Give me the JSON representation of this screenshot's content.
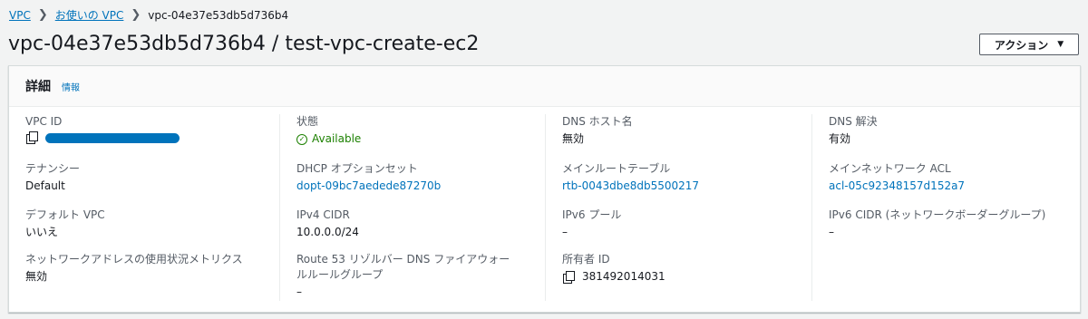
{
  "breadcrumb": {
    "root": "VPC",
    "parent": "お使いの VPC",
    "current": "vpc-04e37e53db5d736b4"
  },
  "page": {
    "title": "vpc-04e37e53db5d736b4 / test-vpc-create-ec2",
    "actions_label": "アクション"
  },
  "panel": {
    "title": "詳細",
    "info_link": "情報"
  },
  "details": {
    "vpc_id": {
      "label": "VPC ID"
    },
    "tenancy": {
      "label": "テナンシー",
      "value": "Default"
    },
    "default_vpc": {
      "label": "デフォルト VPC",
      "value": "いいえ"
    },
    "network_metrics": {
      "label": "ネットワークアドレスの使用状況メトリクス",
      "value": "無効"
    },
    "state": {
      "label": "状態",
      "value": "Available"
    },
    "dhcp": {
      "label": "DHCP オプションセット",
      "value": "dopt-09bc7aedede87270b"
    },
    "ipv4_cidr": {
      "label": "IPv4 CIDR",
      "value": "10.0.0.0/24"
    },
    "route53": {
      "label": "Route 53 リゾルバー DNS ファイアウォールルールグループ",
      "value": "–"
    },
    "dns_hostnames": {
      "label": "DNS ホスト名",
      "value": "無効"
    },
    "main_route_table": {
      "label": "メインルートテーブル",
      "value": "rtb-0043dbe8db5500217"
    },
    "ipv6_pool": {
      "label": "IPv6 プール",
      "value": "–"
    },
    "owner_id": {
      "label": "所有者 ID",
      "value": "381492014031"
    },
    "dns_resolution": {
      "label": "DNS 解決",
      "value": "有効"
    },
    "main_acl": {
      "label": "メインネットワーク ACL",
      "value": "acl-05c92348157d152a7"
    },
    "ipv6_cidr": {
      "label": "IPv6 CIDR (ネットワークボーダーグループ)",
      "value": "–"
    }
  },
  "colors": {
    "link": "#0073bb",
    "success": "#1d8102",
    "redaction": "#0073bb"
  }
}
